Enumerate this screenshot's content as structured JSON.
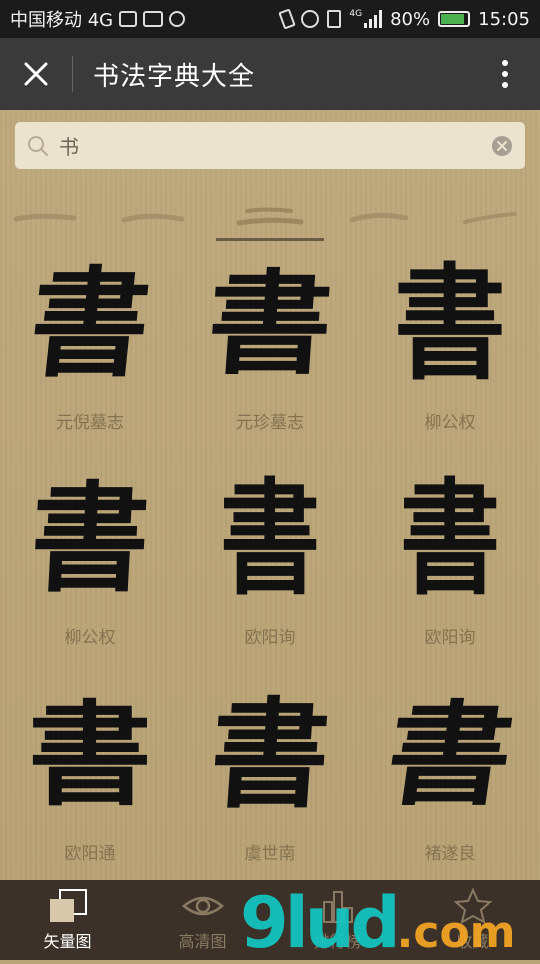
{
  "status_bar": {
    "carrier": "中国移动 4G",
    "battery": "80%",
    "time": "15:05",
    "network_badge": "4G"
  },
  "app_bar": {
    "title": "书法字典大全",
    "close_icon": "close-icon",
    "more_icon": "more-vertical-icon"
  },
  "search": {
    "value": "书",
    "icon": "search-icon",
    "clear_icon": "clear-icon"
  },
  "tabs": [
    {
      "glyph": "一"
    },
    {
      "glyph": "一"
    },
    {
      "glyph": "二"
    },
    {
      "glyph": "一"
    },
    {
      "glyph": "一"
    }
  ],
  "selected_tab_index": 2,
  "results": [
    {
      "glyph": "書",
      "author": "元倪墓志"
    },
    {
      "glyph": "書",
      "author": "元珍墓志"
    },
    {
      "glyph": "書",
      "author": "柳公权"
    },
    {
      "glyph": "書",
      "author": "柳公权"
    },
    {
      "glyph": "書",
      "author": "欧阳询"
    },
    {
      "glyph": "書",
      "author": "欧阳询"
    },
    {
      "glyph": "書",
      "author": "欧阳通"
    },
    {
      "glyph": "書",
      "author": "虞世南"
    },
    {
      "glyph": "書",
      "author": "褚遂良"
    }
  ],
  "bottom_nav": [
    {
      "label": "矢量图",
      "icon": "vector-squares-icon",
      "active": true
    },
    {
      "label": "高清图",
      "icon": "eye-icon",
      "active": false
    },
    {
      "label": "排行榜",
      "icon": "ranking-icon",
      "active": false
    },
    {
      "label": "收藏",
      "icon": "star-icon",
      "active": false
    }
  ],
  "watermark": {
    "text": "9lud",
    "suffix": ".com"
  },
  "colors": {
    "status_bar_bg": "#1b1b1b",
    "app_bar_bg": "#3a3a3a",
    "paper_bg": "#b9a57a",
    "bottom_nav_bg": "#3b3128",
    "nav_active": "#ffffff",
    "nav_inactive": "#8a7a62",
    "label_color": "#847352"
  }
}
